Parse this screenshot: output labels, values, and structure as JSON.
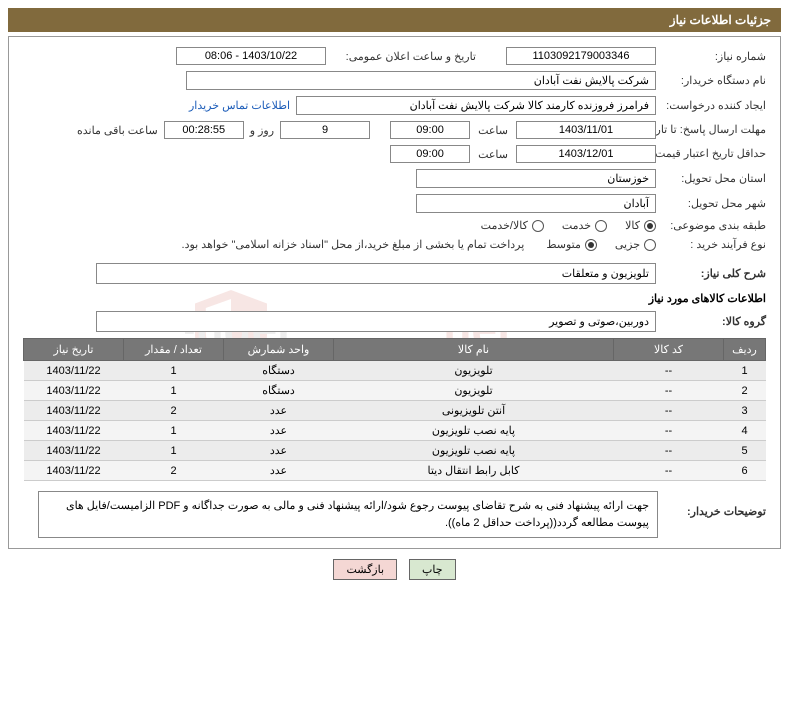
{
  "header": {
    "title": "جزئیات اطلاعات نیاز"
  },
  "labels": {
    "need_no": "شماره نیاز:",
    "announce_dt": "تاریخ و ساعت اعلان عمومی:",
    "buyer_org": "نام دستگاه خریدار:",
    "requester": "ایجاد کننده درخواست:",
    "contact_link": "اطلاعات تماس خریدار",
    "reply_deadline": "مهلت ارسال پاسخ: تا تاریخ:",
    "time": "ساعت",
    "days_and": "روز و",
    "time_left": "ساعت باقی مانده",
    "price_validity": "حداقل تاریخ اعتبار قیمت: تا تاریخ:",
    "delivery_province": "استان محل تحویل:",
    "delivery_city": "شهر محل تحویل:",
    "category": "طبقه بندی موضوعی:",
    "purchase_process": "نوع فرآیند خرید :",
    "process_note": "پرداخت تمام یا بخشی از مبلغ خرید،از محل \"اسناد خزانه اسلامی\" خواهد بود.",
    "general_desc": "شرح کلی نیاز:",
    "items_info": "اطلاعات کالاهای مورد نیاز",
    "goods_group": "گروه کالا:",
    "buyer_notes": "توضیحات خریدار:"
  },
  "values": {
    "need_no": "1103092179003346",
    "announce_dt": "1403/10/22 - 08:06",
    "buyer_org": "شرکت پالایش نفت آبادان",
    "requester": "فرامرز فروزنده کارمند کالا شرکت پالایش نفت آبادان",
    "reply_date": "1403/11/01",
    "reply_time": "09:00",
    "days_left": "9",
    "countdown": "00:28:55",
    "price_date": "1403/12/01",
    "price_time": "09:00",
    "province": "خوزستان",
    "city": "آبادان",
    "general_desc": "تلویزیون و متعلقات",
    "goods_group": "دوربین،صوتی و تصویر",
    "buyer_notes": "جهت ارائه پیشنهاد فنی به شرح تقاضای پیوست رجوع شود/ارائه پیشنهاد فنی و مالی به صورت جداگانه و PDF الزامیست/فایل های پیوست مطالعه گردد((پرداخت حداقل 2 ماه))."
  },
  "radios": {
    "category": [
      {
        "label": "کالا",
        "checked": true
      },
      {
        "label": "خدمت",
        "checked": false
      },
      {
        "label": "کالا/خدمت",
        "checked": false
      }
    ],
    "process": [
      {
        "label": "جزیی",
        "checked": false
      },
      {
        "label": "متوسط",
        "checked": true
      }
    ]
  },
  "table": {
    "headers": [
      "ردیف",
      "کد کالا",
      "نام کالا",
      "واحد شمارش",
      "تعداد / مقدار",
      "تاریخ نیاز"
    ],
    "rows": [
      {
        "n": "1",
        "code": "--",
        "name": "تلویزیون",
        "unit": "دستگاه",
        "qty": "1",
        "date": "1403/11/22"
      },
      {
        "n": "2",
        "code": "--",
        "name": "تلویزیون",
        "unit": "دستگاه",
        "qty": "1",
        "date": "1403/11/22"
      },
      {
        "n": "3",
        "code": "--",
        "name": "آنتن تلویزیونی",
        "unit": "عدد",
        "qty": "2",
        "date": "1403/11/22"
      },
      {
        "n": "4",
        "code": "--",
        "name": "پایه نصب تلویزیون",
        "unit": "عدد",
        "qty": "1",
        "date": "1403/11/22"
      },
      {
        "n": "5",
        "code": "--",
        "name": "پایه نصب تلویزیون",
        "unit": "عدد",
        "qty": "1",
        "date": "1403/11/22"
      },
      {
        "n": "6",
        "code": "--",
        "name": "کابل رابط انتقال دیتا",
        "unit": "عدد",
        "qty": "2",
        "date": "1403/11/22"
      }
    ]
  },
  "buttons": {
    "print": "چاپ",
    "back": "بازگشت"
  },
  "watermark": "AriaTender.net"
}
